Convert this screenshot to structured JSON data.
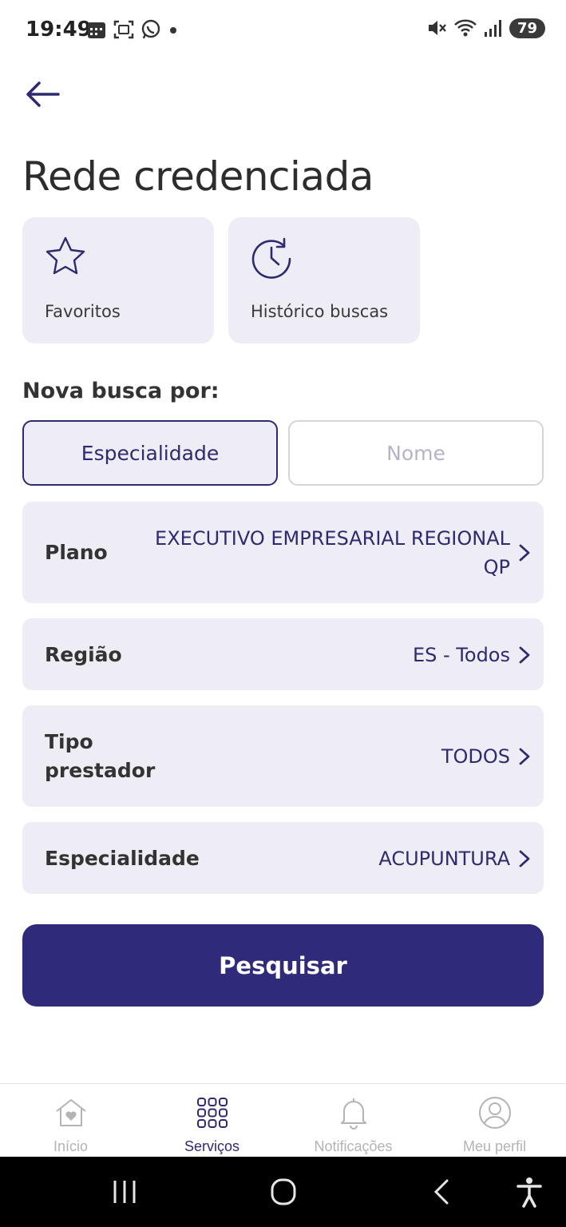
{
  "status_bar": {
    "time": "19:49",
    "battery": "79",
    "left_icons": [
      "calendar-icon",
      "screenshot-icon",
      "whatsapp-icon",
      "dot-icon"
    ],
    "right_icons": [
      "mute-icon",
      "wifi-icon",
      "signal-icon",
      "battery-icon"
    ]
  },
  "header": {
    "back_icon": "arrow-left-icon",
    "title": "Rede credenciada"
  },
  "quick_actions": [
    {
      "label": "Favoritos",
      "icon": "star-icon"
    },
    {
      "label": "Histórico buscas",
      "icon": "history-icon"
    }
  ],
  "search": {
    "section_label": "Nova busca por:",
    "tabs": [
      {
        "label": "Especialidade",
        "active": true
      },
      {
        "label": "Nome",
        "active": false
      }
    ]
  },
  "filters": [
    {
      "label": "Plano",
      "value": "EXECUTIVO EMPRESARIAL REGIONAL QP"
    },
    {
      "label": "Região",
      "value": "ES - Todos"
    },
    {
      "label": "Tipo prestador",
      "value": "TODOS"
    },
    {
      "label": "Especialidade",
      "value": "ACUPUNTURA"
    }
  ],
  "search_button_label": "Pesquisar",
  "bottom_nav": [
    {
      "label": "Início",
      "icon": "home-heart-icon",
      "active": false
    },
    {
      "label": "Serviços",
      "icon": "grid-icon",
      "active": true
    },
    {
      "label": "Notificações",
      "icon": "bell-icon",
      "active": false
    },
    {
      "label": "Meu perfil",
      "icon": "user-circle-icon",
      "active": false
    }
  ],
  "colors": {
    "primary": "#302a7a",
    "card_bg": "#eeedf5",
    "inactive": "#b5b4c6"
  }
}
